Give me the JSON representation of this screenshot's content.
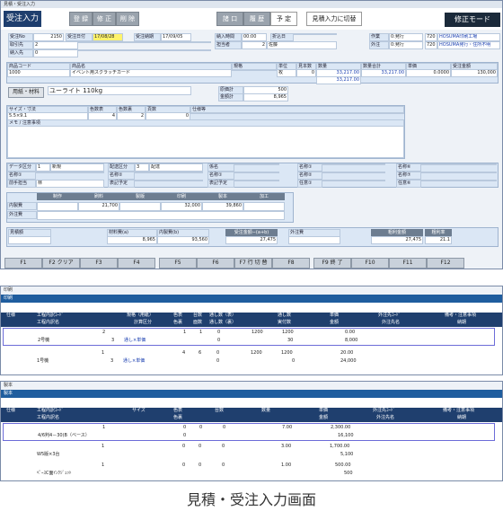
{
  "window": {
    "title": "見積・受注入力"
  },
  "header": {
    "section_title": "受注入力",
    "buttons": [
      "登 録",
      "修 正",
      "削 除"
    ],
    "buttons2": [
      "諸 口",
      "履 歴"
    ],
    "yotei": "予 定",
    "switch_label": "見積入力に切替",
    "mode_label": "修正モード"
  },
  "form": {
    "juchu_no_label": "受注No",
    "juchu_no": "2150",
    "juchu_date_label": "受注日付",
    "juchu_date": "17/08/28",
    "juchu_noki_label": "受注納期",
    "juchu_noki": "17/09/05",
    "nonyu_label": "納入時間",
    "nonyu_time": "00:00",
    "ori_label": "折込日",
    "torihiki_label": "取引先",
    "torihiki_code": "2",
    "tantou_label": "担当者",
    "tantou_code": "2",
    "tantou_name": "佐藤",
    "nonyu_saki_label": "納入先",
    "nonyu_saki_code": "0",
    "sakuhin_label": "作業",
    "sakuhin_sel": "0:発行",
    "sakuhin_val": "720",
    "sakuhin_name": "HOSUMA印刷工場",
    "gaichu_label": "外注",
    "gaichu_sel": "0:発行",
    "gaichu_val": "720",
    "gaichu_name": "HOSUMA発行・住所不明"
  },
  "item": {
    "headers": [
      "商品コード",
      "商品名",
      "規格",
      "単位",
      "見本数",
      "数量",
      "数量合計",
      "単価",
      "受注金額"
    ],
    "code": "1000",
    "name": "イベント用スクラッチカード",
    "unit": "枚",
    "mihon": "0",
    "qty": "33,217.00",
    "qty_total": "33,217.00",
    "price": "0.0000",
    "amount": "130,000",
    "qty2": "33,217.00"
  },
  "paper": {
    "btn": "用紙・材料",
    "name": "ユーライト 110kg",
    "shiire_label": "原価計",
    "shiire": "500",
    "kingaku_label": "金額計",
    "kingaku": "8,965"
  },
  "spec": {
    "headers": [
      "サイズ・寸法",
      "色数表",
      "色数裏",
      "頁数",
      "仕様等"
    ],
    "size": "5.5×9.1",
    "c1": "4",
    "c2": "2",
    "pages": "0",
    "memo_label": "メモ / 注意事項"
  },
  "misc": {
    "data_label": "データ区分",
    "data_val": "1",
    "data_name": "新規",
    "haisou_label": "配送区分",
    "haisou_val": "3",
    "haisou_name": "配達",
    "kakari_label": "係名",
    "kakari_sub": "係名",
    "kanren_label": "名称①",
    "kanren2": "名称②",
    "kanren3": "任意①",
    "name_label": "名称①",
    "name2": "名称②",
    "name3": "任意①",
    "ref_labels": [
      "名称①",
      "名称②",
      "任意①"
    ],
    "right_labels": [
      "名称⑥",
      "名称⑦",
      "任意⑥"
    ],
    "tantou_label": "前手担当",
    "tantou_val": "林",
    "yotei_label": "表記予定",
    "yotei_label2": "表記予定"
  },
  "costs": {
    "headers": [
      "制作",
      "刷料",
      "製版",
      "印刷",
      "製本",
      "加工"
    ],
    "row1_label": "内製費",
    "row2_label": "外注費",
    "vals": [
      "",
      "21,700",
      "",
      "32,000",
      "39,860",
      ""
    ]
  },
  "totals": {
    "mitsumori_label": "見積額",
    "material_label": "材料費(a)",
    "material": "8,965",
    "naisei_label": "内製費(b)",
    "naisei": "93,560",
    "juchu_label": "受注金額−(a+b)",
    "juchu": "27,475",
    "gaichu_label": "外注費",
    "arari_label": "粗利金額",
    "arari": "27,475",
    "rate_label": "粗利率",
    "rate": "21.1"
  },
  "fkeys": [
    "F1",
    "F2 クリア",
    "F3",
    "F4",
    "F5",
    "F6",
    "F7 行 切 替",
    "F8",
    "F9 終 了",
    "F10",
    "F11",
    "F12"
  ],
  "panel1": {
    "title": "印刷",
    "tab": "印刷",
    "headers": [
      "仕様",
      "工程内訳ｺｰﾄﾞ",
      "工程内訳名",
      "規格（用紙）",
      "計算区分",
      "色表",
      "色裏",
      "台数",
      "面数",
      "通し数（表）",
      "通し数（裏）",
      "通し数",
      "実付数",
      "単価",
      "金額",
      "外注先ｺｰﾄﾞ",
      "外注先名",
      "備考・注意事項",
      "納期"
    ],
    "rows": [
      {
        "code": "2",
        "name": "2号機",
        "spec": "3",
        "calc": "通し×単価",
        "c1": "1",
        "c2": "1",
        "dai": "0",
        "men": "1200",
        "tb": "1200",
        "price": "0.00",
        "sub": "0",
        "sub2": "30",
        "amt": "8,000"
      },
      {
        "code": "1",
        "name": "1号機",
        "spec": "3",
        "calc": "通し×単価",
        "c1": "4",
        "c2": "6",
        "dai": "0",
        "men": "1200",
        "tb": "1200",
        "price": "20.00",
        "sub": "0",
        "sub2": "0",
        "amt": "24,000"
      }
    ]
  },
  "panel2": {
    "title": "製本",
    "tab": "製本",
    "headers": [
      "仕様",
      "工程内訳ｺｰﾄﾞ",
      "工程内訳名",
      "サイズ",
      "色表",
      "色裏",
      "台数",
      "数量",
      "単価",
      "金額",
      "外注先ｺｰﾄﾞ",
      "外注先名",
      "備考・注意事項",
      "納期"
    ],
    "rows": [
      {
        "code": "1",
        "name": "4/6判4－30(B（ベース）",
        "c1": "0",
        "c2": "0",
        "dai": "0",
        "qty": "7.00",
        "price": "2,300.00",
        "amt": "16,100"
      },
      {
        "code": "1",
        "name": "W5版×3台",
        "c1": "0",
        "c2": "0",
        "dai": "0",
        "qty": "3.00",
        "price": "1,700.00",
        "amt": "5,100"
      },
      {
        "code": "1",
        "name": "ﾍﾟｰｽC面ｲﾝｸｼﾞｪｯﾄ",
        "c1": "0",
        "c2": "0",
        "dai": "0",
        "qty": "1.00",
        "price": "500.00",
        "amt": "500"
      }
    ]
  },
  "caption": "見積・受注入力画面"
}
